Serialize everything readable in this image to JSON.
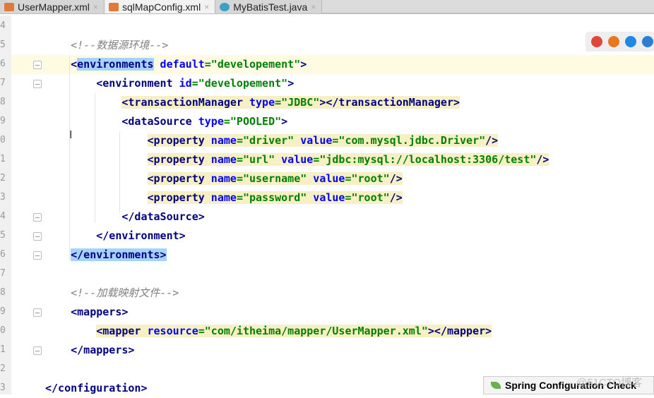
{
  "tabs": [
    {
      "label": "UserMapper.xml",
      "icon": "xml-file-icon",
      "active": false
    },
    {
      "label": "sqlMapConfig.xml",
      "icon": "xml-file-icon",
      "active": true
    },
    {
      "label": "MyBatisTest.java",
      "icon": "java-class-icon",
      "active": false
    }
  ],
  "tab_close": "×",
  "line_numbers": [
    "4",
    "5",
    "6",
    "7",
    "8",
    "9",
    "0",
    "1",
    "2",
    "3",
    "4",
    "5",
    "6",
    "7",
    "8",
    "9",
    "0",
    "1",
    "2",
    "3"
  ],
  "code_lines": [
    [],
    [
      {
        "s": "    "
      },
      {
        "s": "<!--数据源环境-->",
        "k": "c"
      }
    ],
    [
      {
        "s": "    "
      },
      {
        "s": "<",
        "k": "t"
      },
      {
        "s": "environments",
        "k": "t sel"
      },
      {
        "s": " default",
        "k": "a"
      },
      {
        "s": "=\"developement\"",
        "k": "v"
      },
      {
        "s": ">",
        "k": "t"
      }
    ],
    [
      {
        "s": "        "
      },
      {
        "s": "<environment",
        "k": "t"
      },
      {
        "s": " id",
        "k": "a"
      },
      {
        "s": "=\"developement\"",
        "k": "v"
      },
      {
        "s": ">",
        "k": "t"
      }
    ],
    [
      {
        "s": "            "
      },
      {
        "s": "<transactionManager",
        "k": "t hl"
      },
      {
        "s": " type",
        "k": "a hl"
      },
      {
        "s": "=\"JDBC\"",
        "k": "v hl"
      },
      {
        "s": "></transactionManager>",
        "k": "t hl"
      }
    ],
    [
      {
        "s": "            "
      },
      {
        "s": "<dataSource",
        "k": "t"
      },
      {
        "s": " type",
        "k": "a"
      },
      {
        "s": "=\"POOLED\"",
        "k": "v"
      },
      {
        "s": ">",
        "k": "t"
      }
    ],
    [
      {
        "s": "                "
      },
      {
        "s": "<property",
        "k": "t hl"
      },
      {
        "s": " name",
        "k": "a hl"
      },
      {
        "s": "=\"driver\"",
        "k": "v hl"
      },
      {
        "s": " value",
        "k": "a hl"
      },
      {
        "s": "=\"com.mysql.jdbc.Driver\"",
        "k": "v hl"
      },
      {
        "s": "/>",
        "k": "t hl"
      }
    ],
    [
      {
        "s": "                "
      },
      {
        "s": "<property",
        "k": "t hl"
      },
      {
        "s": " name",
        "k": "a hl"
      },
      {
        "s": "=\"url\"",
        "k": "v hl"
      },
      {
        "s": " value",
        "k": "a hl"
      },
      {
        "s": "=\"jdbc:mysql://localhost:3306/test\"",
        "k": "v hl"
      },
      {
        "s": "/>",
        "k": "t hl"
      }
    ],
    [
      {
        "s": "                "
      },
      {
        "s": "<property",
        "k": "t hl"
      },
      {
        "s": " name",
        "k": "a hl"
      },
      {
        "s": "=\"username\"",
        "k": "v hl"
      },
      {
        "s": " value",
        "k": "a hl"
      },
      {
        "s": "=\"root\"",
        "k": "v hl"
      },
      {
        "s": "/>",
        "k": "t hl"
      }
    ],
    [
      {
        "s": "                "
      },
      {
        "s": "<property",
        "k": "t hl"
      },
      {
        "s": " name",
        "k": "a hl"
      },
      {
        "s": "=\"password\"",
        "k": "v hl"
      },
      {
        "s": " value",
        "k": "a hl"
      },
      {
        "s": "=\"root\"",
        "k": "v hl"
      },
      {
        "s": "/>",
        "k": "t hl"
      }
    ],
    [
      {
        "s": "            "
      },
      {
        "s": "</dataSource>",
        "k": "t"
      }
    ],
    [
      {
        "s": "        "
      },
      {
        "s": "</environment>",
        "k": "t"
      }
    ],
    [
      {
        "s": "    "
      },
      {
        "s": "</environments>",
        "k": "t sel"
      }
    ],
    [],
    [
      {
        "s": "    "
      },
      {
        "s": "<!--加载映射文件-->",
        "k": "c"
      }
    ],
    [
      {
        "s": "    "
      },
      {
        "s": "<mappers>",
        "k": "t"
      }
    ],
    [
      {
        "s": "        "
      },
      {
        "s": "<mapper",
        "k": "t hl"
      },
      {
        "s": " resource",
        "k": "a hl"
      },
      {
        "s": "=\"com/itheima/mapper/UserMapper.xml\"",
        "k": "v hl"
      },
      {
        "s": "></mapper>",
        "k": "t hl"
      }
    ],
    [
      {
        "s": "    "
      },
      {
        "s": "</mappers>",
        "k": "t"
      }
    ],
    [],
    [
      {
        "s": "</configuration>",
        "k": "t"
      }
    ]
  ],
  "browser_icons": [
    "chrome-icon",
    "firefox-icon",
    "safari-icon",
    "ie-icon"
  ],
  "browser_colors": [
    "#e0463a",
    "#e87722",
    "#1e88e5",
    "#2a7fd4"
  ],
  "notification": {
    "label": "Spring Configuration Check",
    "icon": "spring-leaf-icon"
  },
  "watermark": "@51CTO博客"
}
